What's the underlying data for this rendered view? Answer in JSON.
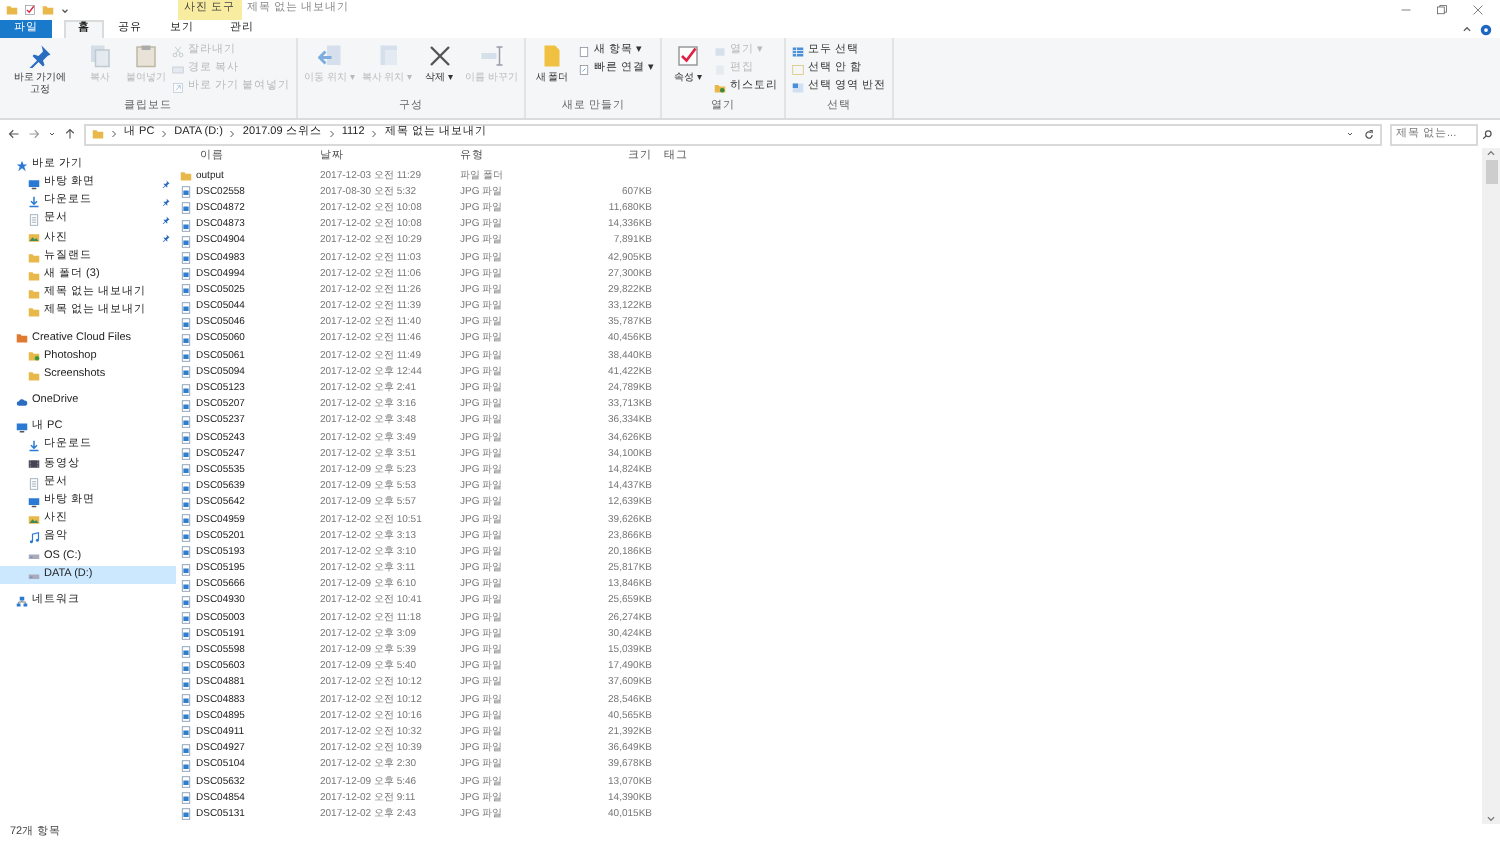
{
  "window": {
    "context_tab": "사진 도구",
    "title": "제목 없는 내보내기"
  },
  "tabs": [
    {
      "label": "파일",
      "kind": "file",
      "selected": false
    },
    {
      "label": "홈",
      "kind": "normal",
      "selected": true
    },
    {
      "label": "공유",
      "kind": "normal",
      "selected": false
    },
    {
      "label": "보기",
      "kind": "normal",
      "selected": false
    },
    {
      "label": "관리",
      "kind": "context",
      "selected": false
    }
  ],
  "ribbon": [
    {
      "label": "클립보드",
      "buttons": [
        {
          "label": "바로 가기에 고정",
          "kind": "large",
          "disabled": false
        },
        {
          "label": "복사",
          "kind": "large",
          "disabled": true
        },
        {
          "label": "붙여넣기",
          "kind": "large",
          "disabled": true
        },
        {
          "label": "잘라내기",
          "kind": "small",
          "disabled": true
        },
        {
          "label": "경로 복사",
          "kind": "small",
          "disabled": true
        },
        {
          "label": "바로 가기 붙여넣기",
          "kind": "small",
          "disabled": true
        }
      ]
    },
    {
      "label": "구성",
      "buttons": [
        {
          "label": "이동 위치 ▾",
          "kind": "large",
          "disabled": true
        },
        {
          "label": "복사 위치 ▾",
          "kind": "large",
          "disabled": true
        },
        {
          "label": "삭제 ▾",
          "kind": "large",
          "disabled": false
        },
        {
          "label": "이름 바꾸기",
          "kind": "large",
          "disabled": true
        }
      ]
    },
    {
      "label": "새로 만들기",
      "buttons": [
        {
          "label": "새 폴더",
          "kind": "large",
          "disabled": false
        },
        {
          "label": "새 항목 ▾",
          "kind": "small",
          "disabled": false
        },
        {
          "label": "빠른 연결 ▾",
          "kind": "small",
          "disabled": false
        }
      ]
    },
    {
      "label": "열기",
      "buttons": [
        {
          "label": "속성 ▾",
          "kind": "large",
          "disabled": false
        },
        {
          "label": "열기 ▾",
          "kind": "small",
          "disabled": true
        },
        {
          "label": "편집",
          "kind": "small",
          "disabled": true
        },
        {
          "label": "히스토리",
          "kind": "small",
          "disabled": false
        }
      ]
    },
    {
      "label": "선택",
      "buttons": [
        {
          "label": "모두 선택",
          "kind": "small",
          "disabled": false
        },
        {
          "label": "선택 안 함",
          "kind": "small",
          "disabled": false
        },
        {
          "label": "선택 영역 반전",
          "kind": "small",
          "disabled": false
        }
      ]
    }
  ],
  "address": {
    "path": [
      "내 PC",
      "DATA (D:)",
      "2017.09 스위스",
      "1112",
      "제목 없는 내보내기"
    ],
    "search_placeholder": "제목 없는..."
  },
  "navigation": [
    {
      "label": "바로 가기",
      "selected": false,
      "children": [
        {
          "label": "바탕 화면",
          "pinned": true,
          "selected": false
        },
        {
          "label": "다운로드",
          "pinned": true,
          "selected": false
        },
        {
          "label": "문서",
          "pinned": true,
          "selected": false
        },
        {
          "label": "사진",
          "pinned": true,
          "selected": false
        },
        {
          "label": "뉴질랜드",
          "pinned": false,
          "selected": false
        },
        {
          "label": "새 폴더 (3)",
          "pinned": false,
          "selected": false
        },
        {
          "label": "제목 없는 내보내기",
          "pinned": false,
          "selected": false
        },
        {
          "label": "제목 없는 내보내기",
          "pinned": false,
          "selected": false
        }
      ]
    },
    {
      "label": "Creative Cloud Files",
      "selected": false,
      "children": [
        {
          "label": "Photoshop",
          "pinned": false,
          "selected": false
        },
        {
          "label": "Screenshots",
          "pinned": false,
          "selected": false
        }
      ]
    },
    {
      "label": "OneDrive",
      "selected": false
    },
    {
      "label": "내 PC",
      "selected": false,
      "children": [
        {
          "label": "다운로드",
          "pinned": false,
          "selected": false
        },
        {
          "label": "동영상",
          "pinned": false,
          "selected": false
        },
        {
          "label": "문서",
          "pinned": false,
          "selected": false
        },
        {
          "label": "바탕 화면",
          "pinned": false,
          "selected": false
        },
        {
          "label": "사진",
          "pinned": false,
          "selected": false
        },
        {
          "label": "음악",
          "pinned": false,
          "selected": false
        },
        {
          "label": "OS (C:)",
          "pinned": false,
          "selected": false
        },
        {
          "label": "DATA (D:)",
          "pinned": false,
          "selected": true
        }
      ]
    },
    {
      "label": "네트워크",
      "selected": false
    }
  ],
  "table": {
    "columns": [
      "이름",
      "날짜",
      "유형",
      "크기",
      "태그"
    ],
    "rows": [
      {
        "kind": "folder",
        "name": "output",
        "date": "2017-12-03 오전 11:29",
        "type": "파일 폴더",
        "size": ""
      },
      {
        "kind": "image",
        "name": "DSC02558",
        "date": "2017-08-30 오전 5:32",
        "type": "JPG 파일",
        "size": "607KB"
      },
      {
        "kind": "image",
        "name": "DSC04872",
        "date": "2017-12-02 오전 10:08",
        "type": "JPG 파일",
        "size": "11,680KB"
      },
      {
        "kind": "image",
        "name": "DSC04873",
        "date": "2017-12-02 오전 10:08",
        "type": "JPG 파일",
        "size": "14,336KB"
      },
      {
        "kind": "image",
        "name": "DSC04904",
        "date": "2017-12-02 오전 10:29",
        "type": "JPG 파일",
        "size": "7,891KB"
      },
      {
        "kind": "image",
        "name": "DSC04983",
        "date": "2017-12-02 오전 11:03",
        "type": "JPG 파일",
        "size": "42,905KB"
      },
      {
        "kind": "image",
        "name": "DSC04994",
        "date": "2017-12-02 오전 11:06",
        "type": "JPG 파일",
        "size": "27,300KB"
      },
      {
        "kind": "image",
        "name": "DSC05025",
        "date": "2017-12-02 오전 11:26",
        "type": "JPG 파일",
        "size": "29,822KB"
      },
      {
        "kind": "image",
        "name": "DSC05044",
        "date": "2017-12-02 오전 11:39",
        "type": "JPG 파일",
        "size": "33,122KB"
      },
      {
        "kind": "image",
        "name": "DSC05046",
        "date": "2017-12-02 오전 11:40",
        "type": "JPG 파일",
        "size": "35,787KB"
      },
      {
        "kind": "image",
        "name": "DSC05060",
        "date": "2017-12-02 오전 11:46",
        "type": "JPG 파일",
        "size": "40,456KB"
      },
      {
        "kind": "image",
        "name": "DSC05061",
        "date": "2017-12-02 오전 11:49",
        "type": "JPG 파일",
        "size": "38,440KB"
      },
      {
        "kind": "image",
        "name": "DSC05094",
        "date": "2017-12-02 오후 12:44",
        "type": "JPG 파일",
        "size": "41,422KB"
      },
      {
        "kind": "image",
        "name": "DSC05123",
        "date": "2017-12-02 오후 2:41",
        "type": "JPG 파일",
        "size": "24,789KB"
      },
      {
        "kind": "image",
        "name": "DSC05207",
        "date": "2017-12-02 오후 3:16",
        "type": "JPG 파일",
        "size": "33,713KB"
      },
      {
        "kind": "image",
        "name": "DSC05237",
        "date": "2017-12-02 오후 3:48",
        "type": "JPG 파일",
        "size": "36,334KB"
      },
      {
        "kind": "image",
        "name": "DSC05243",
        "date": "2017-12-02 오후 3:49",
        "type": "JPG 파일",
        "size": "34,626KB"
      },
      {
        "kind": "image",
        "name": "DSC05247",
        "date": "2017-12-02 오후 3:51",
        "type": "JPG 파일",
        "size": "34,100KB"
      },
      {
        "kind": "image",
        "name": "DSC05535",
        "date": "2017-12-09 오후 5:23",
        "type": "JPG 파일",
        "size": "14,824KB"
      },
      {
        "kind": "image",
        "name": "DSC05639",
        "date": "2017-12-09 오후 5:53",
        "type": "JPG 파일",
        "size": "14,437KB"
      },
      {
        "kind": "image",
        "name": "DSC05642",
        "date": "2017-12-09 오후 5:57",
        "type": "JPG 파일",
        "size": "12,639KB"
      },
      {
        "kind": "image",
        "name": "DSC04959",
        "date": "2017-12-02 오전 10:51",
        "type": "JPG 파일",
        "size": "39,626KB"
      },
      {
        "kind": "image",
        "name": "DSC05201",
        "date": "2017-12-02 오후 3:13",
        "type": "JPG 파일",
        "size": "23,866KB"
      },
      {
        "kind": "image",
        "name": "DSC05193",
        "date": "2017-12-02 오후 3:10",
        "type": "JPG 파일",
        "size": "20,186KB"
      },
      {
        "kind": "image",
        "name": "DSC05195",
        "date": "2017-12-02 오후 3:11",
        "type": "JPG 파일",
        "size": "25,817KB"
      },
      {
        "kind": "image",
        "name": "DSC05666",
        "date": "2017-12-09 오후 6:10",
        "type": "JPG 파일",
        "size": "13,846KB"
      },
      {
        "kind": "image",
        "name": "DSC04930",
        "date": "2017-12-02 오전 10:41",
        "type": "JPG 파일",
        "size": "25,659KB"
      },
      {
        "kind": "image",
        "name": "DSC05003",
        "date": "2017-12-02 오전 11:18",
        "type": "JPG 파일",
        "size": "26,274KB"
      },
      {
        "kind": "image",
        "name": "DSC05191",
        "date": "2017-12-02 오후 3:09",
        "type": "JPG 파일",
        "size": "30,424KB"
      },
      {
        "kind": "image",
        "name": "DSC05598",
        "date": "2017-12-09 오후 5:39",
        "type": "JPG 파일",
        "size": "15,039KB"
      },
      {
        "kind": "image",
        "name": "DSC05603",
        "date": "2017-12-09 오후 5:40",
        "type": "JPG 파일",
        "size": "17,490KB"
      },
      {
        "kind": "image",
        "name": "DSC04881",
        "date": "2017-12-02 오전 10:12",
        "type": "JPG 파일",
        "size": "37,609KB"
      },
      {
        "kind": "image",
        "name": "DSC04883",
        "date": "2017-12-02 오전 10:12",
        "type": "JPG 파일",
        "size": "28,546KB"
      },
      {
        "kind": "image",
        "name": "DSC04895",
        "date": "2017-12-02 오전 10:16",
        "type": "JPG 파일",
        "size": "40,565KB"
      },
      {
        "kind": "image",
        "name": "DSC04911",
        "date": "2017-12-02 오전 10:32",
        "type": "JPG 파일",
        "size": "21,392KB"
      },
      {
        "kind": "image",
        "name": "DSC04927",
        "date": "2017-12-02 오전 10:39",
        "type": "JPG 파일",
        "size": "36,649KB"
      },
      {
        "kind": "image",
        "name": "DSC05104",
        "date": "2017-12-02 오후 2:30",
        "type": "JPG 파일",
        "size": "39,678KB"
      },
      {
        "kind": "image",
        "name": "DSC05632",
        "date": "2017-12-09 오후 5:46",
        "type": "JPG 파일",
        "size": "13,070KB"
      },
      {
        "kind": "image",
        "name": "DSC04854",
        "date": "2017-12-02 오전 9:11",
        "type": "JPG 파일",
        "size": "14,390KB"
      },
      {
        "kind": "image",
        "name": "DSC05131",
        "date": "2017-12-02 오후 2:43",
        "type": "JPG 파일",
        "size": "40,015KB"
      }
    ]
  },
  "status_bar": {
    "count": "72개 항목"
  }
}
